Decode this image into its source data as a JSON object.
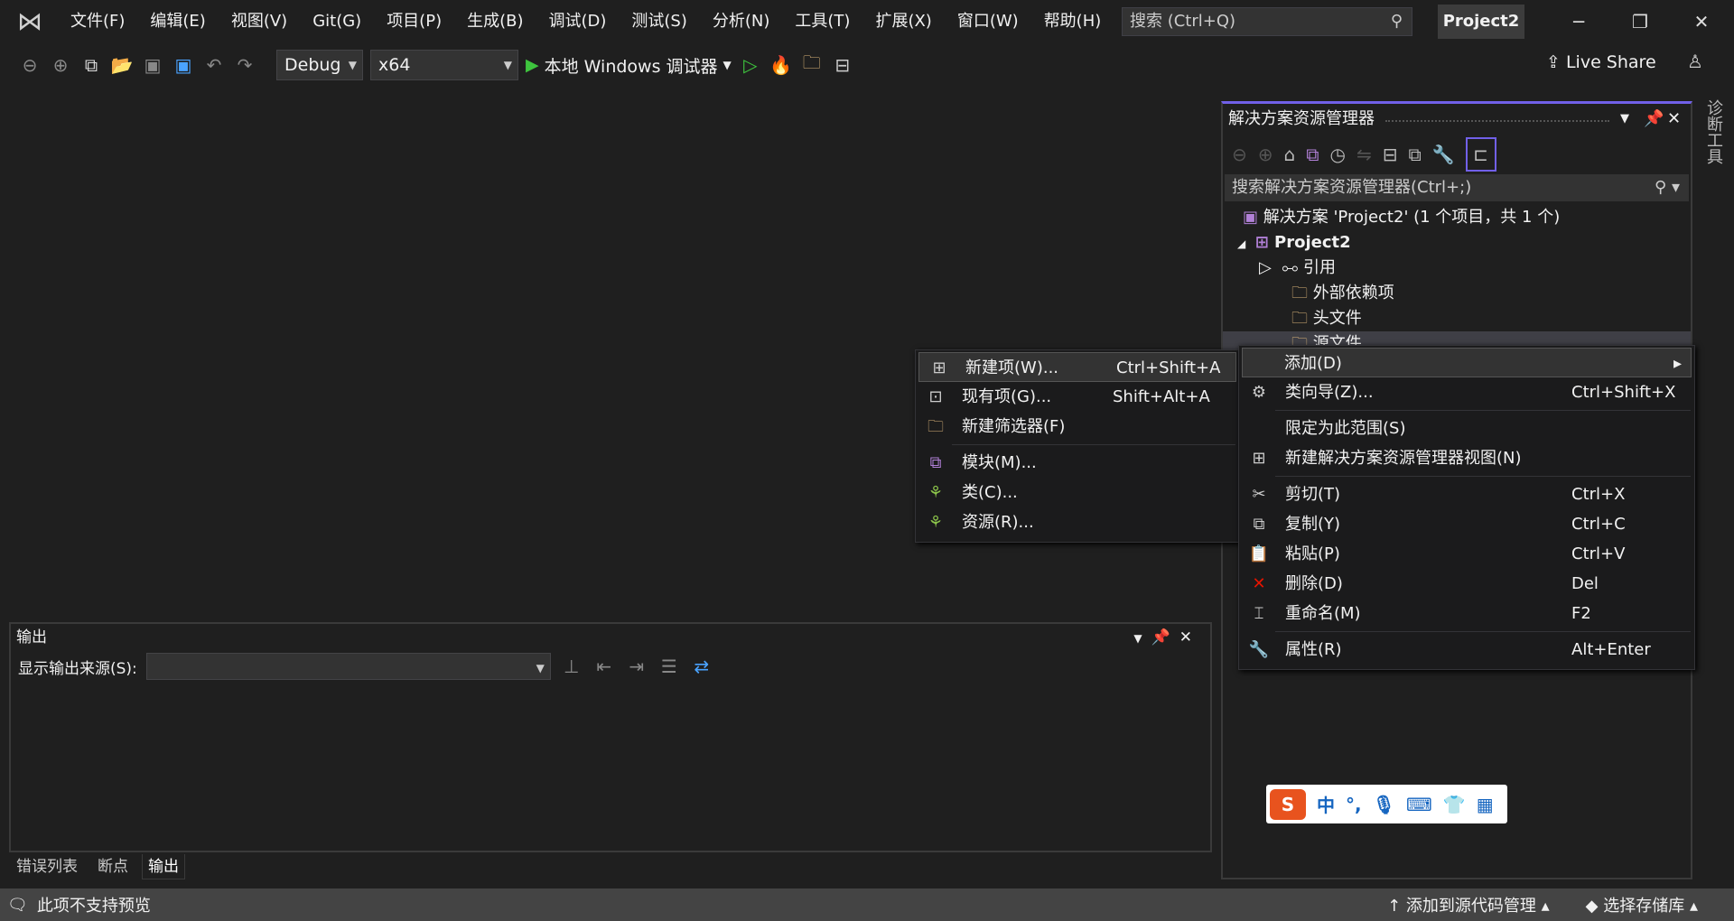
{
  "menubar": {
    "items": [
      "文件(F)",
      "编辑(E)",
      "视图(V)",
      "Git(G)",
      "项目(P)",
      "生成(B)",
      "调试(D)",
      "测试(S)",
      "分析(N)",
      "工具(T)",
      "扩展(X)",
      "窗口(W)",
      "帮助(H)"
    ],
    "search_placeholder": "搜索 (Ctrl+Q)",
    "project": "Project2"
  },
  "toolbar": {
    "config": "Debug",
    "platform": "x64",
    "run_label": "本地 Windows 调试器",
    "live_share": "Live Share"
  },
  "solution_explorer": {
    "title": "解决方案资源管理器",
    "search_placeholder": "搜索解决方案资源管理器(Ctrl+;)",
    "tree": {
      "solution": "解决方案 'Project2' (1 个项目，共 1 个)",
      "project": "Project2",
      "refs": "引用",
      "external": "外部依赖项",
      "headers": "头文件",
      "sources": "源文件"
    }
  },
  "side_tab": "诊断工具",
  "output": {
    "title": "输出",
    "source_label": "显示输出来源(S):",
    "source_value": ""
  },
  "bottom_tabs": [
    "错误列表",
    "断点",
    "输出"
  ],
  "status": {
    "left": "此项不支持预览",
    "source_control": "添加到源代码管理",
    "repo": "选择存储库"
  },
  "context_menu": {
    "items": [
      {
        "label": "添加(D)",
        "shortcut": ""
      },
      {
        "label": "类向导(Z)...",
        "shortcut": "Ctrl+Shift+X"
      },
      {
        "label": "限定为此范围(S)",
        "shortcut": ""
      },
      {
        "label": "新建解决方案资源管理器视图(N)",
        "shortcut": ""
      },
      {
        "label": "剪切(T)",
        "shortcut": "Ctrl+X"
      },
      {
        "label": "复制(Y)",
        "shortcut": "Ctrl+C"
      },
      {
        "label": "粘贴(P)",
        "shortcut": "Ctrl+V"
      },
      {
        "label": "删除(D)",
        "shortcut": "Del"
      },
      {
        "label": "重命名(M)",
        "shortcut": "F2"
      },
      {
        "label": "属性(R)",
        "shortcut": "Alt+Enter"
      }
    ]
  },
  "submenu": {
    "items": [
      {
        "label": "新建项(W)...",
        "shortcut": "Ctrl+Shift+A"
      },
      {
        "label": "现有项(G)...",
        "shortcut": "Shift+Alt+A"
      },
      {
        "label": "新建筛选器(F)",
        "shortcut": ""
      },
      {
        "label": "模块(M)...",
        "shortcut": ""
      },
      {
        "label": "类(C)...",
        "shortcut": ""
      },
      {
        "label": "资源(R)...",
        "shortcut": ""
      }
    ]
  },
  "ime": {
    "mode": "中",
    "punct": "°,"
  },
  "colors": {
    "accent": "#7160e8",
    "background": "#1f1f1f",
    "status_bar": "#444444"
  }
}
